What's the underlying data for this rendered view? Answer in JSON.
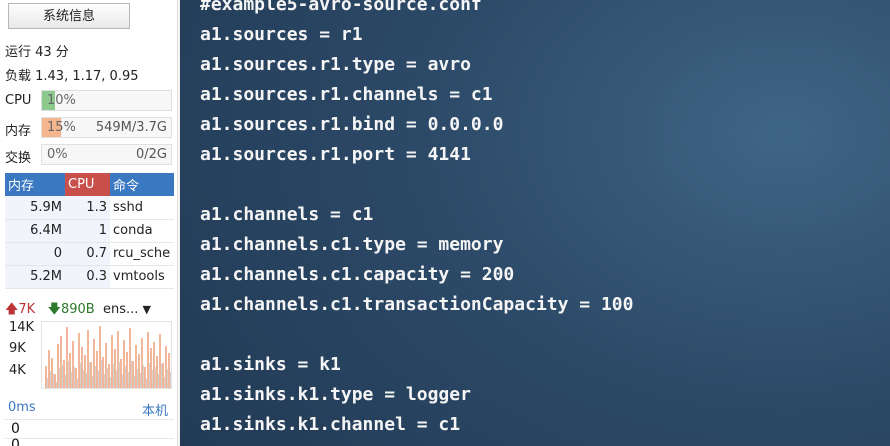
{
  "sidebar": {
    "sysinfo_button": "系统信息",
    "uptime": "运行 43 分",
    "load": "负载 1.43, 1.17, 0.95",
    "cpu": {
      "label": "CPU",
      "percent_text": "10%",
      "fill": 0.1,
      "color": "#8cc98c"
    },
    "mem": {
      "label": "内存",
      "percent_text": "15%",
      "detail": "549M/3.7G",
      "fill": 0.15,
      "color": "#f5b68e"
    },
    "swap": {
      "label": "交换",
      "percent_text": "0%",
      "detail": "0/2G",
      "fill": 0.0,
      "color": "#cccccc"
    },
    "process_table": {
      "headers": [
        "内存",
        "CPU",
        "命令"
      ],
      "rows": [
        {
          "mem": "5.9M",
          "cpu": "1.3",
          "cmd": "sshd"
        },
        {
          "mem": "6.4M",
          "cpu": "1",
          "cmd": "conda"
        },
        {
          "mem": "0",
          "cpu": "0.7",
          "cmd": "rcu_sche"
        },
        {
          "mem": "5.2M",
          "cpu": "0.3",
          "cmd": "vmtools"
        }
      ]
    },
    "network": {
      "upload": "7K",
      "download": "890B",
      "interface": "ens..."
    },
    "graph_labels": [
      "14K",
      "9K",
      "4K"
    ],
    "ping": {
      "latency": "0ms",
      "host": "本机"
    },
    "zero1": "0",
    "zero2": "0"
  },
  "terminal": {
    "lines": [
      "#example5-avro-source.conf",
      "a1.sources = r1",
      "a1.sources.r1.type = avro",
      "a1.sources.r1.channels = c1",
      "a1.sources.r1.bind = 0.0.0.0",
      "a1.sources.r1.port = 4141",
      "",
      "a1.channels = c1",
      "a1.channels.c1.type = memory",
      "a1.channels.c1.capacity = 200",
      "a1.channels.c1.transactionCapacity = 100",
      "",
      "a1.sinks = k1",
      "a1.sinks.k1.type = logger",
      "a1.sinks.k1.channel = c1"
    ]
  }
}
